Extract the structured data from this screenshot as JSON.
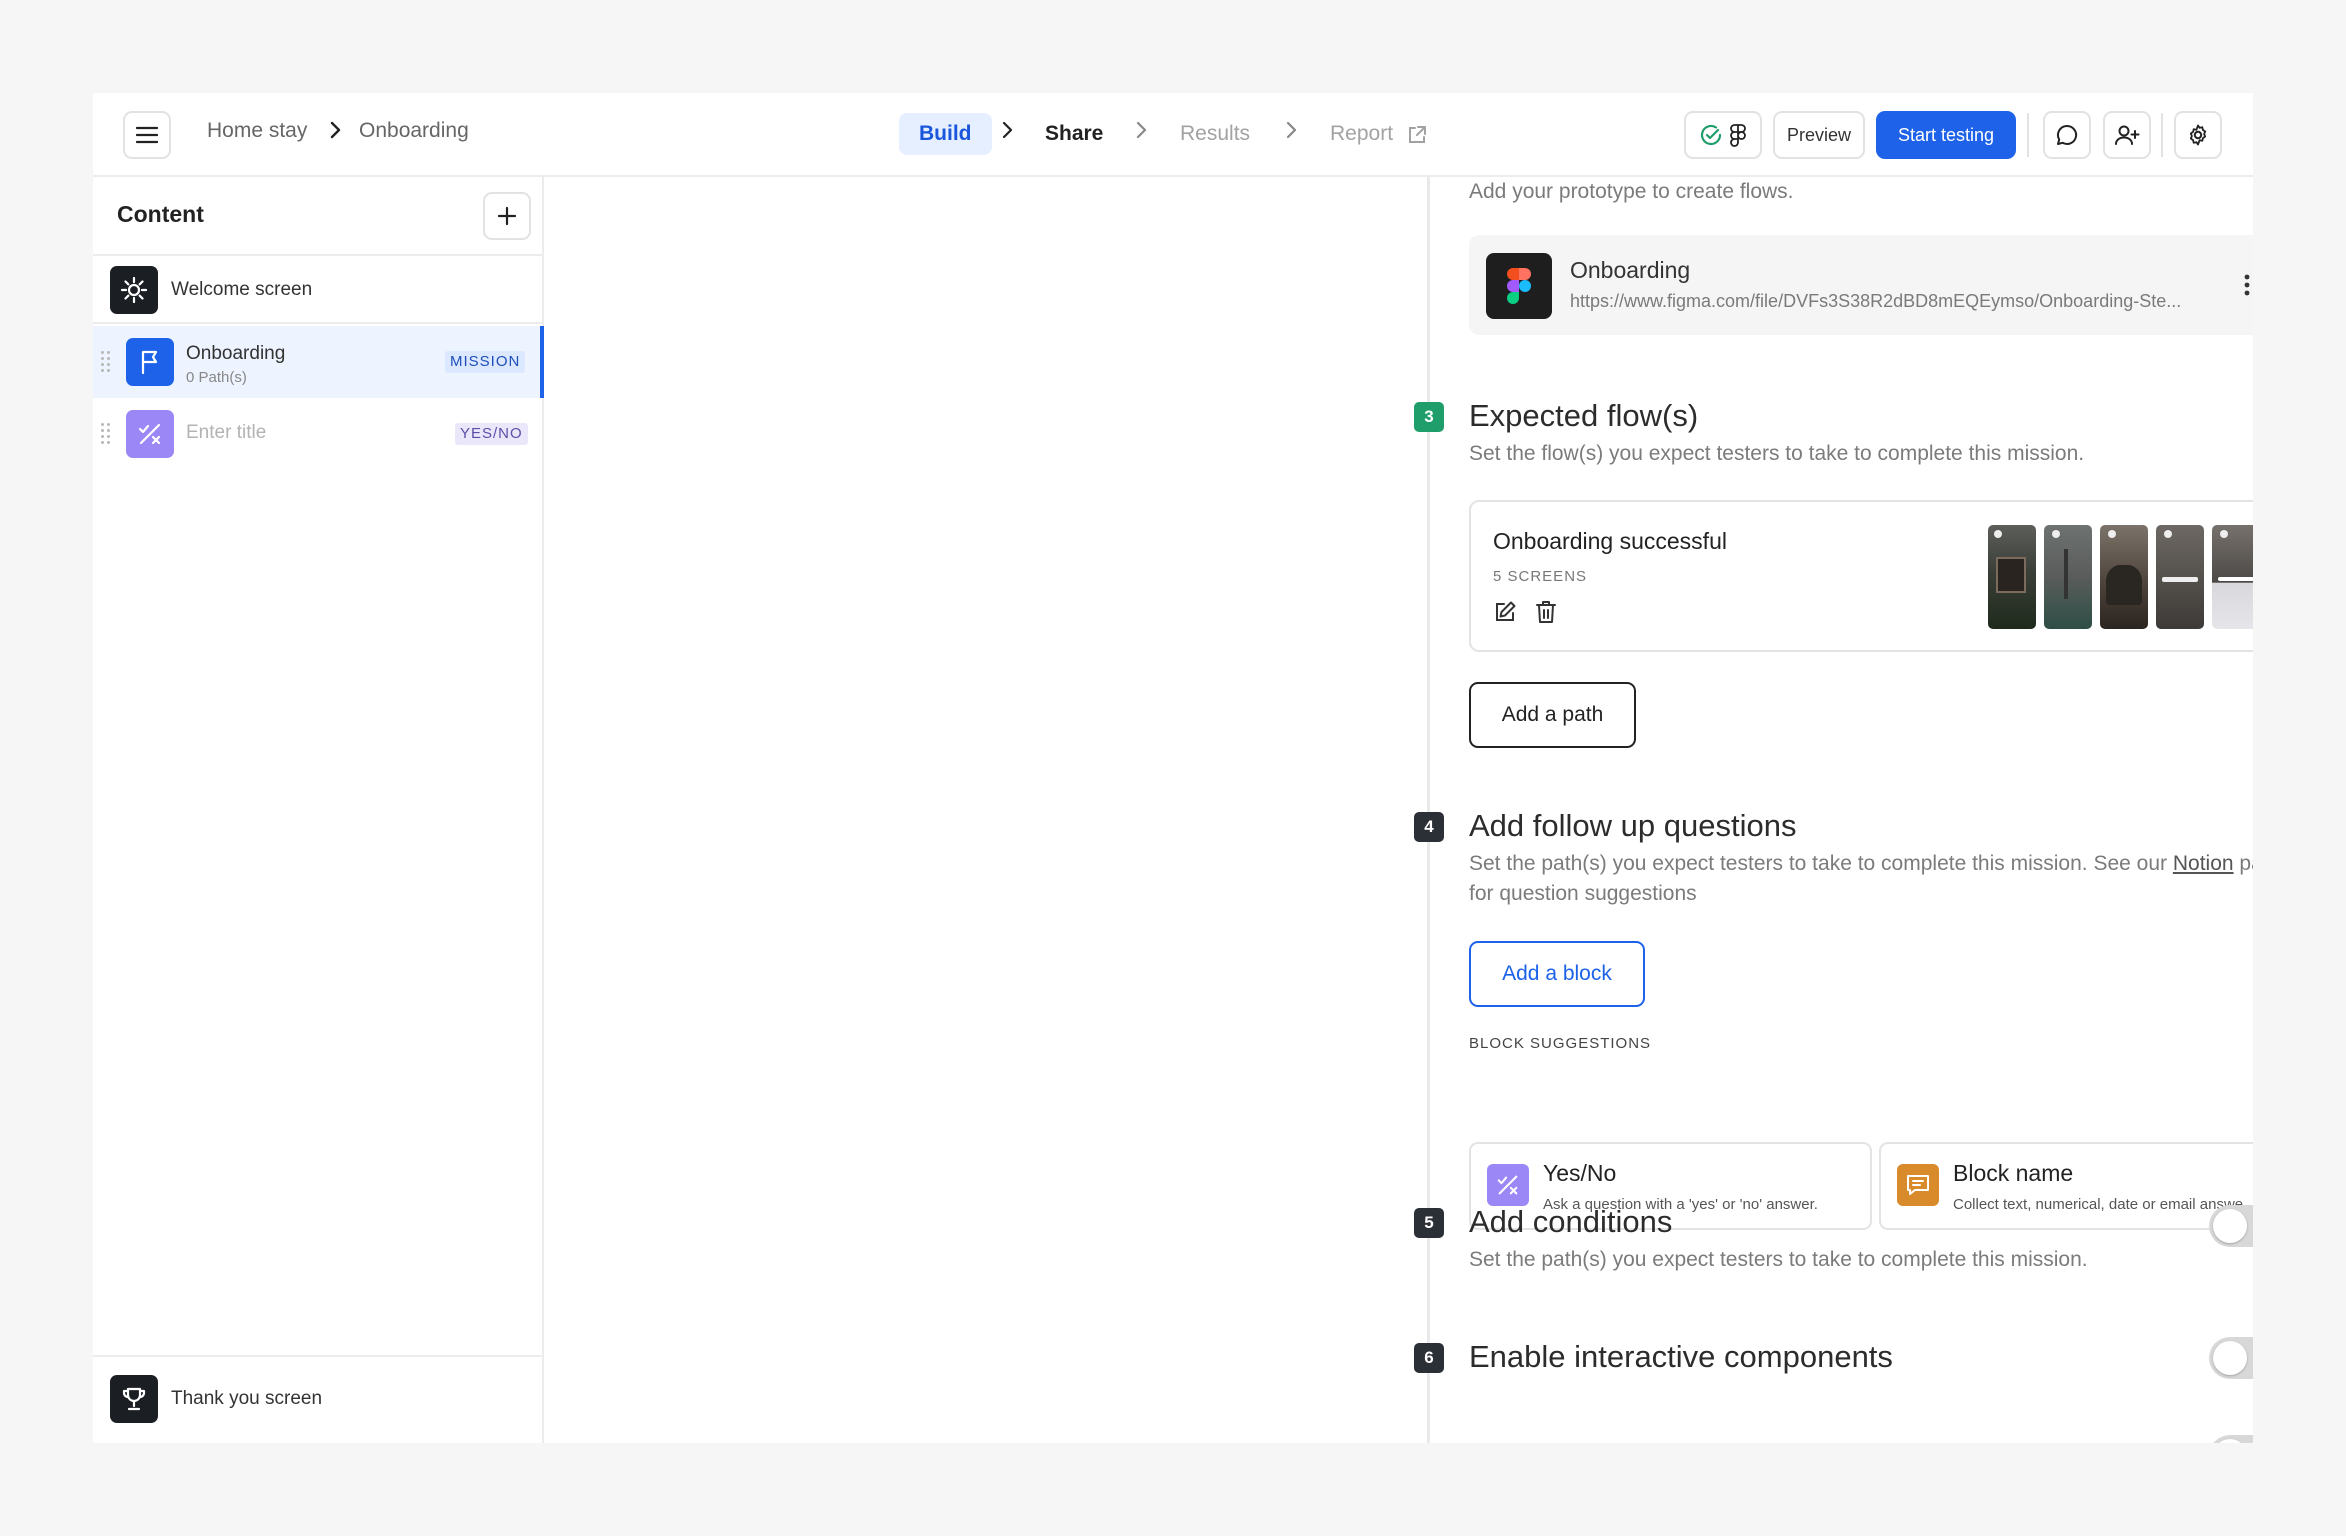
{
  "breadcrumb": {
    "project": "Home stay",
    "page": "Onboarding"
  },
  "steps": {
    "build": "Build",
    "share": "Share",
    "results": "Results",
    "report": "Report"
  },
  "actions": {
    "preview": "Preview",
    "start_testing": "Start testing"
  },
  "sidebar": {
    "title": "Content",
    "welcome": "Welcome screen",
    "items": [
      {
        "label": "Onboarding",
        "sublabel": "0 Path(s)",
        "badge": "MISSION"
      },
      {
        "label": "",
        "placeholder": "Enter title",
        "badge": "YES/NO"
      }
    ],
    "thank_you": "Thank you screen"
  },
  "prototype": {
    "hint": "Add your prototype to create flows.",
    "name": "Onboarding",
    "url": "https://www.figma.com/file/DVFs3S38R2dBD8mEQEymso/Onboarding-Ste..."
  },
  "section3": {
    "num": "3",
    "title": "Expected flow(s)",
    "desc": "Set the flow(s) you expect testers to take to complete this mission.",
    "flow_name": "Onboarding successful",
    "flow_count": "5 SCREENS",
    "add_path": "Add a path"
  },
  "section4": {
    "num": "4",
    "title": "Add follow up questions",
    "desc_before": "Set the path(s) you expect testers to take to complete this mission. See our ",
    "desc_link": "Notion",
    "desc_after": " page for question suggestions",
    "add_block": "Add a block",
    "suggestions_label": "BLOCK SUGGESTIONS",
    "suggestions": [
      {
        "name": "Yes/No",
        "desc": "Ask a question with a 'yes' or 'no' answer."
      },
      {
        "name": "Block name",
        "desc": "Collect text, numerical, date or email answe..."
      }
    ]
  },
  "section5": {
    "num": "5",
    "title": "Add conditions",
    "desc": "Set the path(s) you expect testers to take to complete this mission.",
    "enabled": false
  },
  "section6": {
    "num": "6",
    "title": "Enable interactive components",
    "enabled": false
  },
  "colors": {
    "primary": "#1d62e8",
    "step_green": "#1f9d6b",
    "step_dark": "#2b2f36",
    "yes_no_purple": "#9b87f5",
    "block_orange": "#d98a2b"
  }
}
